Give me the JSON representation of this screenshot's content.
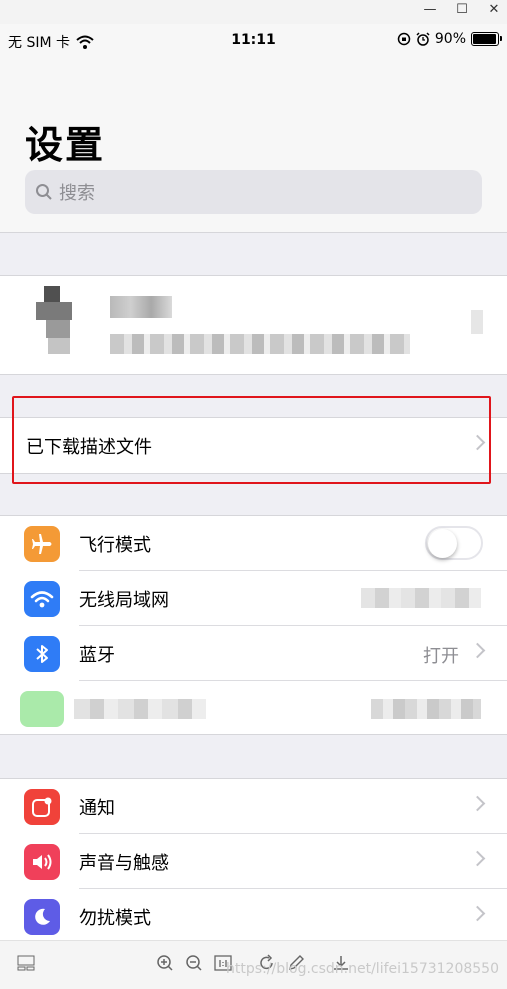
{
  "window": {
    "minimize": "—",
    "maximize": "☐",
    "close": "✕"
  },
  "status_bar": {
    "carrier": "无 SIM 卡",
    "time": "11:11",
    "battery_percent": "90%",
    "battery_level": 0.9
  },
  "page": {
    "title": "设置"
  },
  "search": {
    "placeholder": "搜索"
  },
  "profile_card": {
    "blurred": true
  },
  "profile_download": {
    "label": "已下载描述文件"
  },
  "connectivity": [
    {
      "label": "飞行模式",
      "icon": "airplane-icon",
      "color": "#f49a36",
      "toggle": false
    },
    {
      "label": "无线局域网",
      "icon": "wifi-icon",
      "color": "#2f7cf6",
      "value_blurred": true
    },
    {
      "label": "蓝牙",
      "icon": "bluetooth-icon",
      "color": "#2f7cf6",
      "value": "打开"
    },
    {
      "label": "",
      "icon": "cellular-icon",
      "color": "#8fe08f",
      "blurred": true
    }
  ],
  "system": [
    {
      "label": "通知",
      "icon": "notification-icon",
      "color": "#f0423a"
    },
    {
      "label": "声音与触感",
      "icon": "sound-icon",
      "color": "#f0405a"
    },
    {
      "label": "勿扰模式",
      "icon": "moon-icon",
      "color": "#5e5ce6"
    }
  ],
  "toolbar": {
    "watermark": "https://blog.csdn.net/lifei15731208550"
  },
  "colors": {
    "highlight": "#e0151b",
    "background": "#efeff4"
  }
}
